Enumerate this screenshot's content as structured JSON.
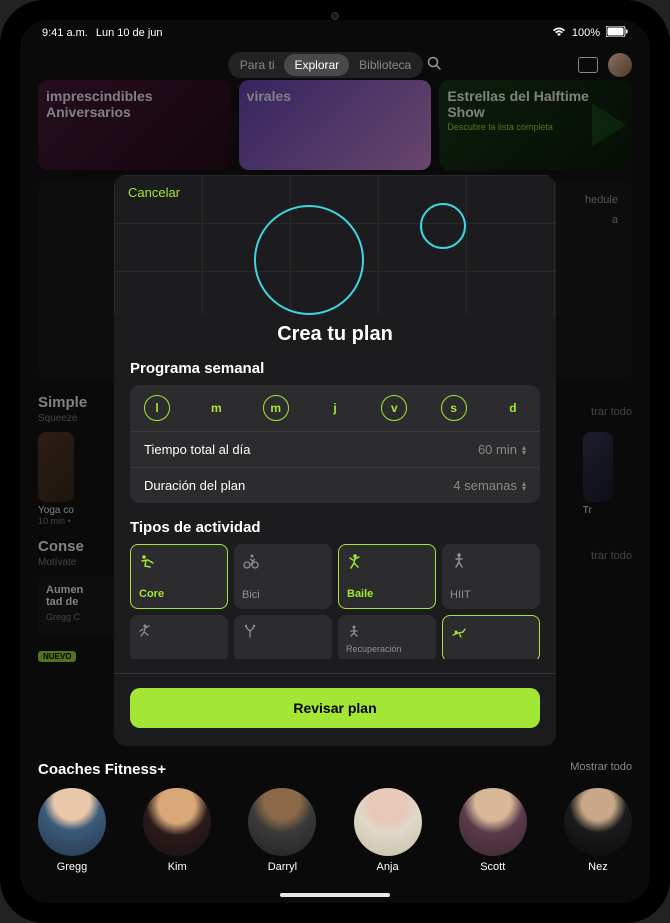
{
  "status": {
    "time": "9:41 a.m.",
    "date": "Lun 10 de jun",
    "battery": "100%"
  },
  "nav": {
    "tabs": [
      "Para ti",
      "Explorar",
      "Biblioteca"
    ],
    "active_index": 1
  },
  "bg_cards": [
    {
      "title": "imprescindibles Aniversarios"
    },
    {
      "title": "virales"
    },
    {
      "title": "Estrellas del Halftime Show",
      "subtitle": "Descubre la lista completa"
    }
  ],
  "bg_sections": {
    "simple": {
      "title": "Simple",
      "subtitle": "Squeeze",
      "show_all": "trar todo"
    },
    "yoga_label": "Yoga co",
    "yoga_sub": "10 min •",
    "tr_label": "Tr",
    "conse": {
      "title": "Conse",
      "subtitle": "Motívate",
      "show_all": "trar todo",
      "new_badge": "NUEVO"
    },
    "pill": {
      "title": "Aumen\ntad de",
      "sub": "Gregg C"
    },
    "schedule_hint": "hedule",
    "schedule_sub": "a"
  },
  "coaches": {
    "title": "Coaches Fitness+",
    "show_all": "Mostrar todo",
    "list": [
      {
        "name": "Gregg",
        "bg": "radial-gradient(circle at 50% 20%, #e8c8a8 0%, #e8c8a8 28%, #3a5a7a 45%, #26384d 100%)"
      },
      {
        "name": "Kim",
        "bg": "radial-gradient(circle at 50% 25%, #d8a878 0%, #d8a878 30%, #2a1a1a 50%, #1a1010 100%)"
      },
      {
        "name": "Darryl",
        "bg": "radial-gradient(circle at 50% 20%, #8a6848 0%, #8a6848 28%, #3a3a3a 48%, #222 100%)"
      },
      {
        "name": "Anja",
        "bg": "radial-gradient(circle at 50% 22%, #e8c8b8 0%, #e8c8b8 28%, #e0d8c8 48%, #c8c0a8 100%)"
      },
      {
        "name": "Scott",
        "bg": "radial-gradient(circle at 50% 22%, #d8b898 0%, #d8b898 28%, #5a3a4a 48%, #3a2a32 100%)"
      },
      {
        "name": "Nez",
        "bg": "radial-gradient(circle at 50% 24%, #c8a888 0%, #c8a888 26%, #1a1a1a 46%, #0a0a0a 100%)"
      }
    ]
  },
  "modal": {
    "cancel": "Cancelar",
    "title": "Crea tu plan",
    "schedule_label": "Programa semanal",
    "days": [
      {
        "label": "l",
        "selected": true
      },
      {
        "label": "m",
        "selected": false
      },
      {
        "label": "m",
        "selected": true
      },
      {
        "label": "j",
        "selected": false
      },
      {
        "label": "v",
        "selected": true
      },
      {
        "label": "s",
        "selected": true
      },
      {
        "label": "d",
        "selected": false
      }
    ],
    "time_label": "Tiempo total al día",
    "time_value": "60 min",
    "duration_label": "Duración del plan",
    "duration_value": "4 semanas",
    "activity_label": "Tipos de actividad",
    "activities": [
      {
        "label": "Core",
        "selected": true
      },
      {
        "label": "Bici",
        "selected": false
      },
      {
        "label": "Baile",
        "selected": true
      },
      {
        "label": "HIIT",
        "selected": false
      }
    ],
    "activities_row2": [
      {
        "label": "",
        "selected": false
      },
      {
        "label": "",
        "selected": false
      },
      {
        "label": "Recuperación",
        "selected": false
      },
      {
        "label": "",
        "selected": true
      }
    ],
    "review_button": "Revisar plan"
  },
  "accent_color": "#a3e635"
}
